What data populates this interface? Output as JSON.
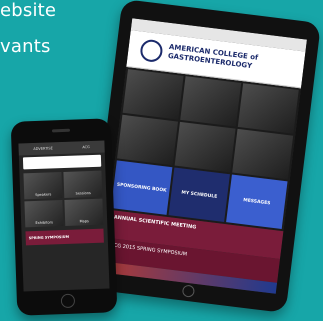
{
  "background_text": [
    "ebsite",
    "vants"
  ],
  "tablet": {
    "logo_line1": "AMERICAN COLLEGE of",
    "logo_line2": "GASTROENTEROLOGY",
    "tiles": [
      "SPONSORING BOOK",
      "MY SCHEDULE",
      "MESSAGES"
    ],
    "banner": "ANNUAL SCIENTIFIC MEETING",
    "banner2": "ACG 2015 SPRING SYMPOSIUM"
  },
  "phone": {
    "nav": [
      "ADVERTISE",
      "ACG"
    ],
    "cells": [
      "Speakers",
      "Sessions",
      "Exhibitors",
      "Maps"
    ],
    "banner": "SPRING SYMPOSIUM"
  },
  "colors": {
    "background": "#17a6a8",
    "brand_navy": "#1b2a6b",
    "maroon": "#7a1c3a",
    "blue": "#3457c4"
  }
}
